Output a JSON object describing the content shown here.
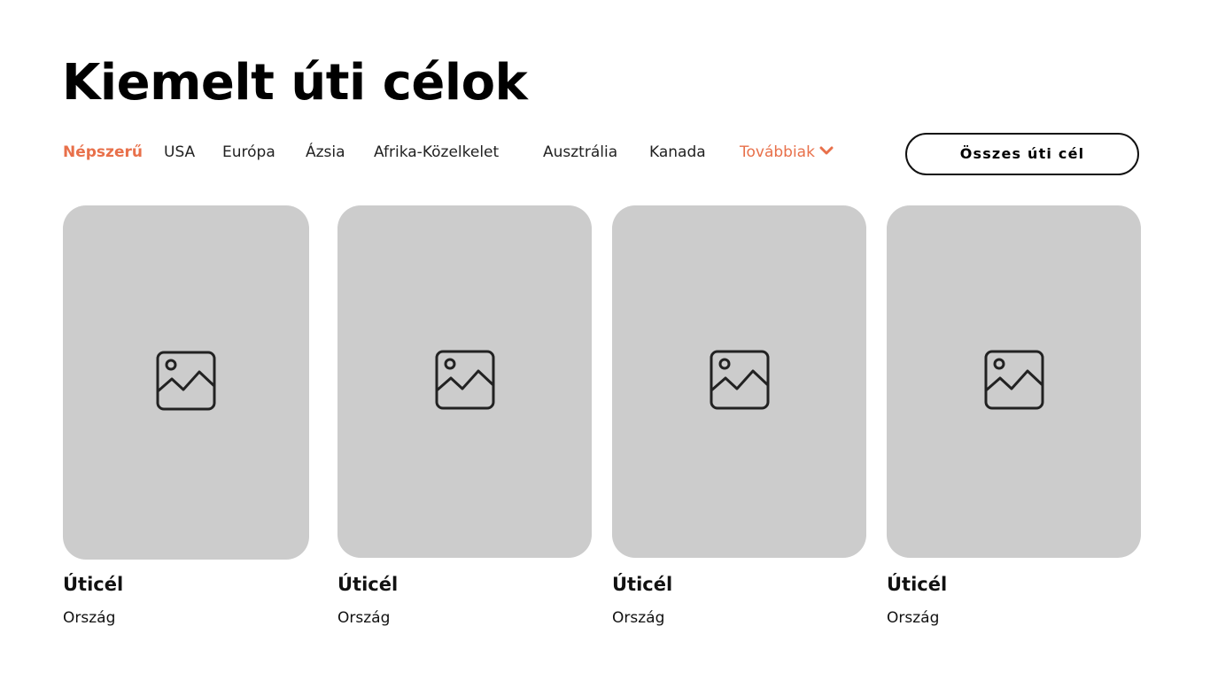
{
  "section": {
    "title": "Kiemelt úti célok"
  },
  "tabs": [
    {
      "label": "Népszerű",
      "active": true
    },
    {
      "label": "USA"
    },
    {
      "label": "Európa"
    },
    {
      "label": "Ázsia"
    },
    {
      "label": "Afrika-Közelkelet"
    },
    {
      "label": "Ausztrália"
    },
    {
      "label": "Kanada"
    },
    {
      "label": "Továbbiak",
      "icon": "chevron-down-icon"
    }
  ],
  "all_destinations_button": {
    "label": "Összes úti cél"
  },
  "cards": [
    {
      "title": "Úticél",
      "subtitle": "Ország",
      "icon": "image-placeholder-icon"
    },
    {
      "title": "Úticél",
      "subtitle": "Ország",
      "icon": "image-placeholder-icon"
    },
    {
      "title": "Úticél",
      "subtitle": "Ország",
      "icon": "image-placeholder-icon"
    },
    {
      "title": "Úticél",
      "subtitle": "Ország",
      "icon": "image-placeholder-icon"
    }
  ],
  "colors": {
    "accent": "#e8704a",
    "placeholder": "#cccccc",
    "text": "#111111"
  }
}
